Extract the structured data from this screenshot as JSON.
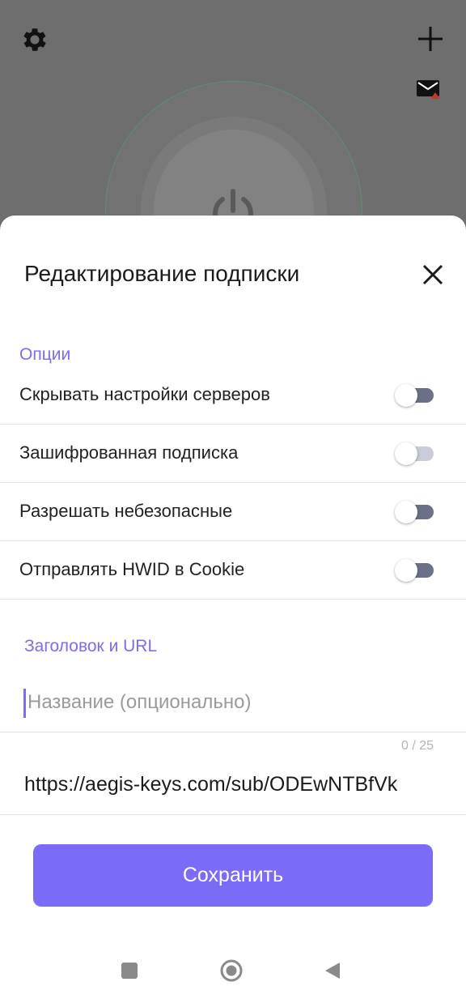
{
  "background_app": {
    "icons": [
      "gear-icon",
      "plus-icon",
      "mail-icon",
      "power-icon"
    ]
  },
  "sheet": {
    "title": "Редактирование подписки",
    "options_section_label": "Опции",
    "options": [
      {
        "label": "Скрывать настройки серверов",
        "enabled": false
      },
      {
        "label": "Зашифрованная подписка",
        "enabled": false
      },
      {
        "label": "Разрешать небезопасные",
        "enabled": false
      },
      {
        "label": "Отправлять HWID в Cookie",
        "enabled": false
      }
    ],
    "title_url_section_label": "Заголовок и URL",
    "name_field": {
      "value": "",
      "placeholder": "Название (опционально)"
    },
    "name_counter": "0 / 25",
    "url_value": "https://aegis-keys.com/sub/ODEwNTBfVk",
    "save_label": "Сохранить"
  },
  "colors": {
    "accent": "#7b6cf7",
    "section_label": "#7b6cf0"
  },
  "navbar": {
    "icons": [
      "recent-apps-icon",
      "home-icon",
      "back-icon"
    ]
  }
}
